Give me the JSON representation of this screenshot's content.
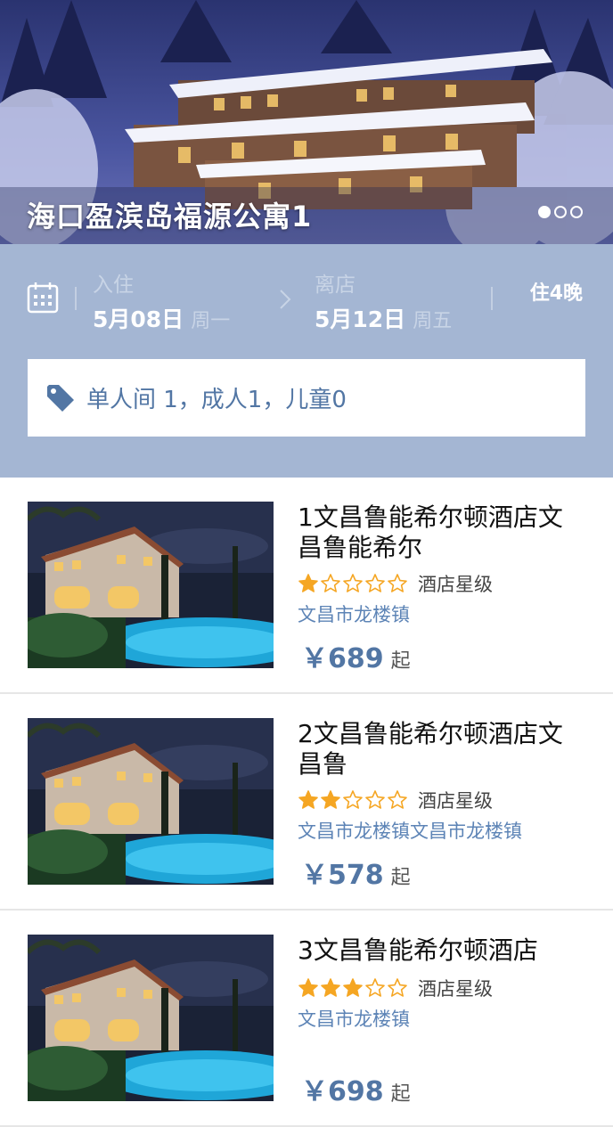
{
  "hero": {
    "title": "海口盈滨岛福源公寓1",
    "slide_total": 3,
    "slide_active": 1
  },
  "booking": {
    "checkin_label": "入住",
    "checkin_date": "5月08日",
    "checkin_weekday": "周一",
    "checkout_label": "离店",
    "checkout_date": "5月12日",
    "checkout_weekday": "周五",
    "nights": "住4晚",
    "room_summary": "单人间 1，成人1，儿童0"
  },
  "colors": {
    "accent": "#5276a4",
    "booking_bg": "#a4b6d3",
    "star": "#f5a623"
  },
  "hotels": [
    {
      "name": "1文昌鲁能希尔顿酒店文昌鲁能希尔",
      "rating": 1,
      "star_label": "酒店星级",
      "location": "文昌市龙楼镇",
      "price": "￥689",
      "price_suffix": "起"
    },
    {
      "name": "2文昌鲁能希尔顿酒店文昌鲁",
      "rating": 2,
      "star_label": "酒店星级",
      "location": "文昌市龙楼镇文昌市龙楼镇",
      "price": "￥578",
      "price_suffix": "起"
    },
    {
      "name": "3文昌鲁能希尔顿酒店",
      "rating": 3,
      "star_label": "酒店星级",
      "location": "文昌市龙楼镇",
      "price": "￥698",
      "price_suffix": "起"
    }
  ]
}
